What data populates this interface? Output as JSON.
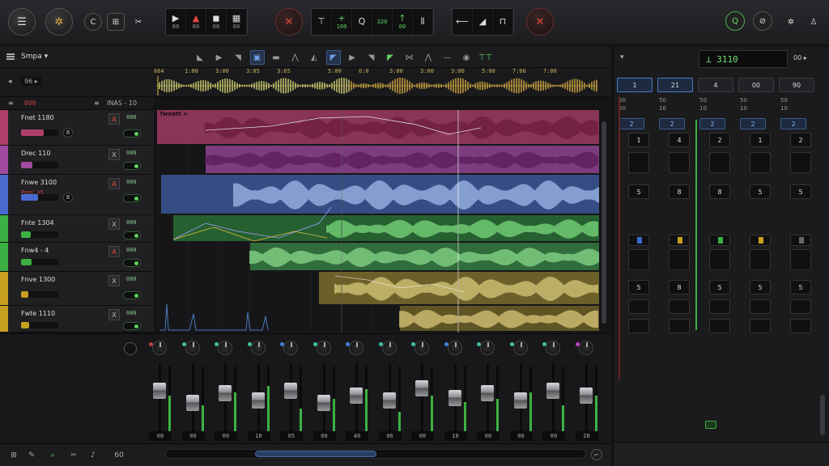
{
  "colors": {
    "accent_green": "#5fd35f",
    "accent_blue": "#4a7bc0",
    "record_red": "#e04a3a",
    "track_colors": [
      "#b0406a",
      "#a04aa0",
      "#4a6ad0",
      "#3cb043",
      "#3cb043",
      "#c8a020",
      "#c8a020"
    ]
  },
  "transport": {
    "left_buttons": [
      {
        "icon": "menu-lines-icon",
        "glyph": "☰"
      },
      {
        "icon": "metronome-gear-icon",
        "glyph": "✲"
      }
    ],
    "small_buttons": [
      {
        "icon": "loop-icon",
        "glyph": "C"
      },
      {
        "icon": "grid-icon",
        "glyph": "⊞"
      },
      {
        "icon": "scissors-icon",
        "glyph": "✂"
      }
    ],
    "box1": [
      {
        "glyph": "▶",
        "value": "60",
        "accent": ""
      },
      {
        "glyph": "▲",
        "value": "60",
        "accent": "red"
      },
      {
        "glyph": "◼",
        "value": "60",
        "accent": ""
      },
      {
        "glyph": "▦",
        "value": "60",
        "accent": ""
      }
    ],
    "record_left_glyph": "✕",
    "box2": [
      {
        "glyph": "⊤",
        "value": "",
        "accent": ""
      },
      {
        "glyph": "+",
        "value": "100",
        "accent": "green"
      },
      {
        "glyph": "Q",
        "value": "",
        "accent": ""
      },
      {
        "glyph": "",
        "value": "320",
        "accent": "green"
      },
      {
        "glyph": "↑",
        "value": "00",
        "accent": "green"
      },
      {
        "glyph": "⫴",
        "value": "",
        "accent": ""
      }
    ],
    "box3": [
      {
        "glyph": "⟵",
        "value": "",
        "accent": ""
      },
      {
        "glyph": "◢",
        "value": "",
        "accent": ""
      },
      {
        "glyph": "⊓",
        "value": "",
        "accent": ""
      }
    ],
    "record_right_glyph": "✕",
    "right_buttons": [
      {
        "icon": "zoom-icon",
        "glyph": "Q"
      },
      {
        "icon": "power-icon",
        "glyph": "⊘"
      },
      {
        "icon": "settings-icon",
        "glyph": "✲"
      },
      {
        "icon": "profile-icon",
        "glyph": "♙"
      }
    ]
  },
  "arrange": {
    "menu_label": "Smpa ▾",
    "tools": [
      "◣",
      "▶",
      "◥",
      "▣",
      "▬",
      "⋀",
      "◭",
      "◤",
      "▶",
      "◥",
      "◤",
      "⋈",
      "⋀",
      "—",
      "◉",
      "⊤⊤"
    ],
    "ruler_labels": [
      "664",
      "1:00",
      "3:00",
      "3:05",
      "3:65",
      "5:00",
      "6:0",
      "3:00",
      "3:00",
      "3:00",
      "5:00",
      "7:00",
      "7:00"
    ],
    "nav_back": "◂",
    "header_small": "96 ▸",
    "header_row": {
      "left": "000",
      "right": "INAS - 10"
    },
    "tracks": [
      {
        "name": "Fnet 1180",
        "value": "000",
        "knob": "8",
        "mute": "A",
        "fill": 60
      },
      {
        "name": "Drec 110",
        "value": "000",
        "knob": "",
        "mute": "X",
        "fill": 30
      },
      {
        "name": "Fnwe 3100",
        "value": "000",
        "knob": "8",
        "mute": "A",
        "fill": 45,
        "sub": "Pres' 35"
      },
      {
        "name": "Fnte 1304",
        "value": "000",
        "knob": "",
        "mute": "X",
        "fill": 25
      },
      {
        "name": "Fnw4 - 4",
        "value": "000",
        "knob": "",
        "mute": "A",
        "fill": 28
      },
      {
        "name": "Fnve 1300",
        "value": "000",
        "knob": "",
        "mute": "X",
        "fill": 20
      },
      {
        "name": "Fwte 1110",
        "value": "000",
        "knob": "",
        "mute": "X",
        "fill": 22
      }
    ],
    "region_label": "Tweatt ="
  },
  "mixer": {
    "channels": [
      {
        "num": "08",
        "level": 55,
        "dot": "#c04040",
        "cap": 60
      },
      {
        "num": "00",
        "level": 40,
        "dot": "#40c0a0",
        "cap": 35
      },
      {
        "num": "00",
        "level": 60,
        "dot": "#40c0a0",
        "cap": 55
      },
      {
        "num": "10",
        "level": 70,
        "dot": "#40c0a0",
        "cap": 40
      },
      {
        "num": "05",
        "level": 35,
        "dot": "#4080e0",
        "cap": 60
      },
      {
        "num": "00",
        "level": 50,
        "dot": "#40c0a0",
        "cap": 35
      },
      {
        "num": "40",
        "level": 65,
        "dot": "#4080e0",
        "cap": 50
      },
      {
        "num": "06",
        "level": 30,
        "dot": "#40c0a0",
        "cap": 40
      },
      {
        "num": "00",
        "level": 55,
        "dot": "#40c0a0",
        "cap": 65
      },
      {
        "num": "10",
        "level": 45,
        "dot": "#4080e0",
        "cap": 45
      },
      {
        "num": "00",
        "level": 50,
        "dot": "#40c0a0",
        "cap": 55
      },
      {
        "num": "00",
        "level": 60,
        "dot": "#40c0a0",
        "cap": 40
      },
      {
        "num": "00",
        "level": 40,
        "dot": "#40c0a0",
        "cap": 60
      },
      {
        "num": "28",
        "level": 55,
        "dot": "#c040c0",
        "cap": 50
      }
    ]
  },
  "bottombar": {
    "icons": [
      {
        "icon": "grid-icon",
        "glyph": "⊞"
      },
      {
        "icon": "edit-icon",
        "glyph": "✎"
      },
      {
        "icon": "zoom-icon",
        "glyph": "⌕"
      },
      {
        "icon": "scissors-icon",
        "glyph": "✂"
      },
      {
        "icon": "note-icon",
        "glyph": "♪"
      },
      {
        "icon": "display-icon",
        "glyph": "60"
      }
    ],
    "collapse": "⌐"
  },
  "rightpanel": {
    "collapse": "▾",
    "display": "⊥ 3110",
    "display_side": "00 ▸",
    "tabs": [
      "1",
      "21",
      "4",
      "00",
      "90"
    ],
    "columns": [
      {
        "hdr1": "50",
        "hdr2": "50",
        "sel": "2",
        "n1": "1",
        "n2": "5",
        "n3": "5",
        "led": "blue"
      },
      {
        "hdr1": "50",
        "hdr2": "16",
        "sel": "2",
        "n1": "4",
        "n2": "8",
        "n3": "8",
        "led": "yellow"
      },
      {
        "hdr1": "50",
        "hdr2": "10",
        "sel": "2",
        "n1": "2",
        "n2": "8",
        "n3": "5",
        "led": "green"
      },
      {
        "hdr1": "50",
        "hdr2": "10",
        "sel": "2",
        "n1": "1",
        "n2": "5",
        "n3": "5",
        "led": "yellow"
      },
      {
        "hdr1": "50",
        "hdr2": "10",
        "sel": "2",
        "n1": "2",
        "n2": "5",
        "n3": "5",
        "led": "gray"
      }
    ]
  }
}
